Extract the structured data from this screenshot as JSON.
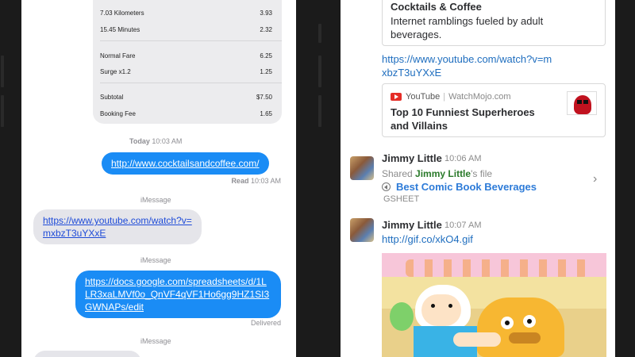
{
  "imessage": {
    "receipt_rows": [
      {
        "label": "7.03 Kilometers",
        "value": "3.93"
      },
      {
        "label": "15.45 Minutes",
        "value": "2.32"
      },
      {
        "label": "Normal Fare",
        "value": "6.25"
      },
      {
        "label": "Surge x1.2",
        "value": "1.25"
      },
      {
        "label": "Subtotal",
        "value": "$7.50"
      },
      {
        "label": "Booking Fee",
        "value": "1.65"
      }
    ],
    "timestamp_day": "Today",
    "timestamp_time": "10:03 AM",
    "msg1": "http://www.cocktailsandcoffee.com/",
    "read_label": "Read",
    "read_time": "10:03 AM",
    "service_label": "iMessage",
    "msg2": "https://www.youtube.com/watch?v=mxbzT3uYXxE",
    "msg3": "https://docs.google.com/spreadsheets/d/1LLR3xaLMVf0o_QnVF4qVF1Ho6gg9HZ1SI3GWNAPs/edit",
    "delivered_label": "Delivered"
  },
  "slack": {
    "card1": {
      "title": "Cocktails & Coffee",
      "desc": "Internet ramblings fueled by adult beverages."
    },
    "yt_link": "https://www.youtube.com/watch?v=mxbzT3uYXxE",
    "card2": {
      "source": "YouTube",
      "channel": "WatchMojo.com",
      "title": "Top 10 Funniest Superheroes and Villains"
    },
    "msg1": {
      "user": "Jimmy Little",
      "time": "10:06 AM",
      "shared_prefix": "Shared",
      "shared_user": "Jimmy Little",
      "shared_suffix": "'s file",
      "file_title": "Best Comic Book Beverages",
      "file_type": "GSHEET"
    },
    "msg2": {
      "user": "Jimmy Little",
      "time": "10:07 AM",
      "link": "http://gif.co/xkO4.gif"
    }
  },
  "colors": {
    "imessage_blue": "#1a8cf5",
    "slack_link": "#1f6ebf",
    "youtube_red": "#e52d27"
  }
}
